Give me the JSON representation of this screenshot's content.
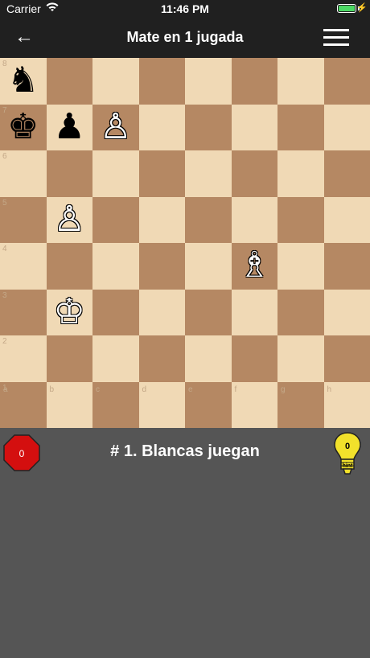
{
  "status": {
    "carrier": "Carrier",
    "time": "11:46 PM"
  },
  "nav": {
    "title": "Mate en 1 jugada",
    "back_icon": "←"
  },
  "board": {
    "ranks": [
      "8",
      "7",
      "6",
      "5",
      "4",
      "3",
      "2",
      "1"
    ],
    "files": [
      "a",
      "b",
      "c",
      "d",
      "e",
      "f",
      "g",
      "h"
    ],
    "pieces": {
      "a8": {
        "glyph": "♞",
        "color": "black"
      },
      "a7": {
        "glyph": "♚",
        "color": "black"
      },
      "b7": {
        "glyph": "♟",
        "color": "black"
      },
      "c7": {
        "glyph": "♙",
        "color": "white"
      },
      "b5": {
        "glyph": "♙",
        "color": "white"
      },
      "f4": {
        "glyph": "♗",
        "color": "white"
      },
      "b3": {
        "glyph": "♔",
        "color": "white"
      }
    },
    "colors": {
      "light": "#f0d9b5",
      "dark": "#b58863"
    }
  },
  "info": {
    "stop_count": "0",
    "turn_text": "# 1. Blancas juegan",
    "hint_count": "0",
    "hint_label": "hint"
  }
}
